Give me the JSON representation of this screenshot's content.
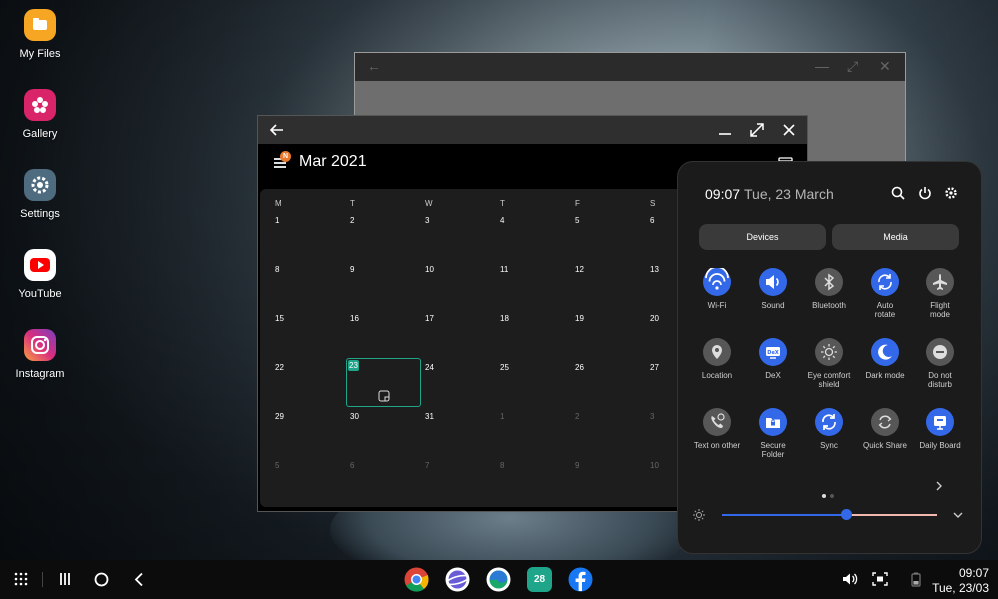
{
  "desktop": {
    "icons": [
      {
        "label": "My Files",
        "icon": "folder-icon",
        "color": "#f6a623"
      },
      {
        "label": "Gallery",
        "icon": "flower-icon",
        "color": "#d9246a"
      },
      {
        "label": "Settings",
        "icon": "gear-icon",
        "color": "#4f6b80"
      },
      {
        "label": "YouTube",
        "icon": "play-icon",
        "color": "#ffffff"
      },
      {
        "label": "Instagram",
        "icon": "camera-icon",
        "color": "#c13584"
      }
    ]
  },
  "calendar": {
    "month_title": "Mar  2021",
    "badge": "N",
    "weekdays": [
      "M",
      "T",
      "W",
      "T",
      "F",
      "S"
    ],
    "weeks": [
      [
        "1",
        "2",
        "3",
        "4",
        "5",
        "6"
      ],
      [
        "8",
        "9",
        "10",
        "11",
        "12",
        "13"
      ],
      [
        "15",
        "16",
        "17",
        "18",
        "19",
        "20"
      ],
      [
        "22",
        "23",
        "24",
        "25",
        "26",
        "27"
      ],
      [
        "29",
        "30",
        "31",
        "1",
        "2",
        "3"
      ],
      [
        "5",
        "6",
        "7",
        "8",
        "9",
        "10"
      ]
    ],
    "today": "23",
    "accent": "#1fa58a"
  },
  "quick_panel": {
    "time": "09:07",
    "date": "Tue, 23 March",
    "tabs": [
      "Devices",
      "Media"
    ],
    "tiles": [
      {
        "label": "Wi-Fi",
        "icon": "wifi-icon",
        "on": true
      },
      {
        "label": "Sound",
        "icon": "speaker-icon",
        "on": true
      },
      {
        "label": "Bluetooth",
        "icon": "bluetooth-icon",
        "on": false
      },
      {
        "label": "Auto\nrotate",
        "icon": "rotate-icon",
        "on": true
      },
      {
        "label": "Flight\nmode",
        "icon": "airplane-icon",
        "on": false
      },
      {
        "label": "Location",
        "icon": "location-icon",
        "on": false
      },
      {
        "label": "DeX",
        "icon": "dex-icon",
        "on": true
      },
      {
        "label": "Eye comfort\nshield",
        "icon": "eye-comfort-icon",
        "on": false
      },
      {
        "label": "Dark mode",
        "icon": "moon-icon",
        "on": true
      },
      {
        "label": "Do not\ndisturb",
        "icon": "dnd-icon",
        "on": false
      },
      {
        "label": "Text on other",
        "icon": "phone-link-icon",
        "on": false
      },
      {
        "label": "Secure\nFolder",
        "icon": "secure-folder-icon",
        "on": true
      },
      {
        "label": "Sync",
        "icon": "sync-icon",
        "on": true
      },
      {
        "label": "Quick Share",
        "icon": "quick-share-icon",
        "on": false
      },
      {
        "label": "Daily Board",
        "icon": "daily-board-icon",
        "on": true
      }
    ],
    "page_indicator": {
      "current": 1,
      "total": 2
    },
    "brightness": 0.58,
    "on_color": "#3369e8"
  },
  "taskbar": {
    "apps": [
      "chrome-icon",
      "samsung-internet-icon",
      "edge-icon",
      "calendar-app-icon",
      "facebook-icon"
    ],
    "calendar_app_day": "28",
    "clock_time": "09:07",
    "clock_date": "Tue, 23/03"
  }
}
